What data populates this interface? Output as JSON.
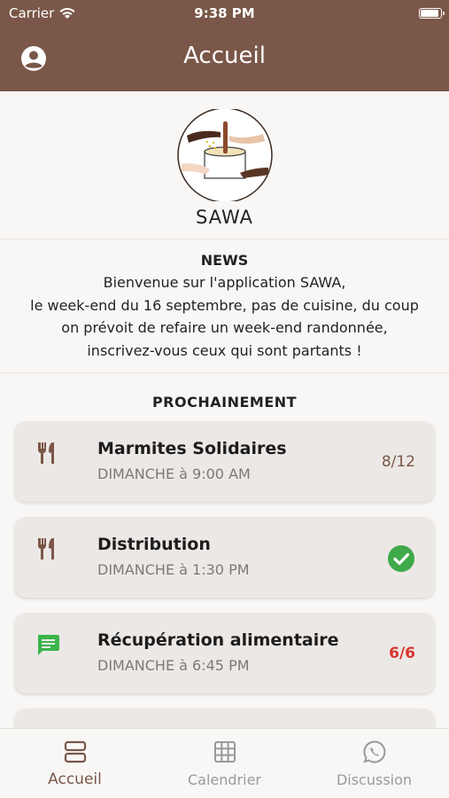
{
  "status_bar": {
    "carrier": "Carrier",
    "time": "9:38 PM"
  },
  "header": {
    "title": "Accueil"
  },
  "logo": {
    "text": "SAWA"
  },
  "news": {
    "title": "NEWS",
    "lines": [
      "Bienvenue sur l'application SAWA,",
      "le week-end du 16 septembre, pas de cuisine, du coup",
      "on prévoit de refaire un week-end randonnée,",
      "inscrivez-vous ceux qui sont partants !"
    ]
  },
  "upcoming": {
    "title": "PROCHAINEMENT",
    "events": [
      {
        "name": "Marmites Solidaires",
        "date": "DIMANCHE à 9:00 AM",
        "status": "8/12",
        "icon": "utensils-icon"
      },
      {
        "name": "Distribution",
        "date": "DIMANCHE à 1:30 PM",
        "status": "",
        "icon": "utensils-icon"
      },
      {
        "name": "Récupération alimentaire",
        "date": "DIMANCHE à 6:45 PM",
        "status": "6/6",
        "icon": "chat-icon"
      }
    ]
  },
  "tabs": [
    {
      "label": "Accueil",
      "icon": "home-icon"
    },
    {
      "label": "Calendrier",
      "icon": "calendar-icon"
    },
    {
      "label": "Discussion",
      "icon": "whatsapp-icon"
    }
  ],
  "colors": {
    "brand": "#7a5748",
    "full": "#d9342b",
    "ok": "#3faa4a",
    "chat": "#3ab54a"
  }
}
